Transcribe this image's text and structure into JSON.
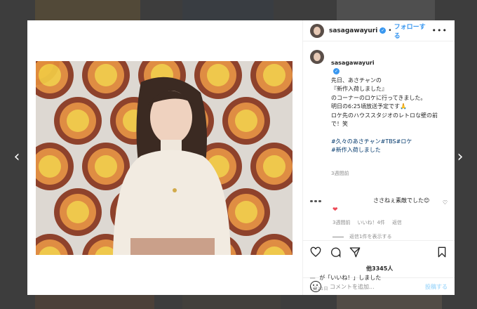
{
  "post": {
    "username": "sasagawayuri",
    "follow_label": "フォローする",
    "more_label": "•••",
    "caption": "先日、あさチャンの\n『新作入荷しました』\nのコーナーのロケに行ってきました。\n明日の6:25頃放送予定です🙏\nロケ先のハウススタジオのレトロな壁の前で！笑",
    "hashtags": "#久々のあさチャン#TBS#ロケ\n#新作入荷しました",
    "caption_time": "3週間前"
  },
  "comment": {
    "text": "ささねぇ素敵でした😊",
    "emoji": "❤",
    "time": "3週間前",
    "likes": "いいね！4件",
    "reply": "返信",
    "view_replies": "返信1件を表示する"
  },
  "likes": {
    "count": "他3345人",
    "liked_by": "が「いいね！」しました"
  },
  "date": "1月21日",
  "add_comment": {
    "placeholder": "コメントを追加...",
    "post_label": "投稿する"
  },
  "nav": {
    "prev": "‹",
    "next": "›"
  }
}
